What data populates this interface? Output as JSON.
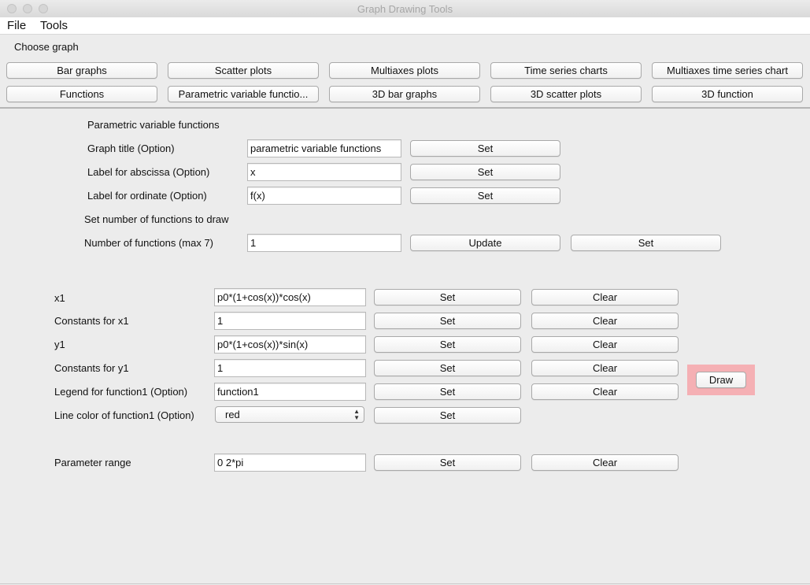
{
  "window": {
    "title": "Graph Drawing Tools"
  },
  "menubar": {
    "file": "File",
    "tools": "Tools"
  },
  "choose_graph": {
    "label": "Choose graph",
    "buttons": [
      "Bar graphs",
      "Scatter plots",
      "Multiaxes plots",
      "Time series charts",
      "Multiaxes time series chart",
      "Functions",
      "Parametric variable functio...",
      "3D bar graphs",
      "3D scatter plots",
      "3D function"
    ]
  },
  "settings": {
    "heading": "Parametric variable functions",
    "graph_title_label": "Graph title (Option)",
    "graph_title_value": "parametric variable functions",
    "abscissa_label": "Label for abscissa (Option)",
    "abscissa_value": "x",
    "ordinate_label": "Label for ordinate (Option)",
    "ordinate_value": "f(x)",
    "set_label": "Set",
    "num_heading": "Set number of functions to draw",
    "num_label": "Number of functions (max 7)",
    "num_value": "1",
    "update_label": "Update"
  },
  "function1": {
    "x_label": "x1",
    "x_value": "p0*(1+cos(x))*cos(x)",
    "x_consts_label": "Constants for x1",
    "x_consts_value": "1",
    "y_label": "y1",
    "y_value": "p0*(1+cos(x))*sin(x)",
    "y_consts_label": "Constants for y1",
    "y_consts_value": "1",
    "legend_label": "Legend for function1 (Option)",
    "legend_value": "function1",
    "color_label": "Line color of function1 (Option)",
    "color_value": "red",
    "set_label": "Set",
    "clear_label": "Clear"
  },
  "parameter": {
    "label": "Parameter range",
    "value": "0 2*pi",
    "set_label": "Set",
    "clear_label": "Clear"
  },
  "draw_label": "Draw",
  "colors": {
    "highlight": "#f5b0b4",
    "background": "#ececec"
  }
}
